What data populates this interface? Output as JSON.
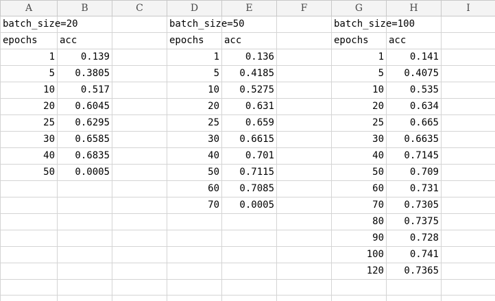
{
  "column_headers": [
    "A",
    "B",
    "C",
    "D",
    "E",
    "F",
    "G",
    "H",
    "I"
  ],
  "blocks": [
    {
      "title": "batch_size=20",
      "headers": [
        "epochs",
        "acc"
      ],
      "rows": [
        [
          "1",
          "0.139"
        ],
        [
          "5",
          "0.3805"
        ],
        [
          "10",
          "0.517"
        ],
        [
          "20",
          "0.6045"
        ],
        [
          "25",
          "0.6295"
        ],
        [
          "30",
          "0.6585"
        ],
        [
          "40",
          "0.6835"
        ],
        [
          "50",
          "0.0005"
        ]
      ]
    },
    {
      "title": "batch_size=50",
      "headers": [
        "epochs",
        "acc"
      ],
      "rows": [
        [
          "1",
          "0.136"
        ],
        [
          "5",
          "0.4185"
        ],
        [
          "10",
          "0.5275"
        ],
        [
          "20",
          "0.631"
        ],
        [
          "25",
          "0.659"
        ],
        [
          "30",
          "0.6615"
        ],
        [
          "40",
          "0.701"
        ],
        [
          "50",
          "0.7115"
        ],
        [
          "60",
          "0.7085"
        ],
        [
          "70",
          "0.0005"
        ]
      ]
    },
    {
      "title": "batch_size=100",
      "headers": [
        "epochs",
        "acc"
      ],
      "rows": [
        [
          "1",
          "0.141"
        ],
        [
          "5",
          "0.4075"
        ],
        [
          "10",
          "0.535"
        ],
        [
          "20",
          "0.634"
        ],
        [
          "25",
          "0.665"
        ],
        [
          "30",
          "0.6635"
        ],
        [
          "40",
          "0.7145"
        ],
        [
          "50",
          "0.709"
        ],
        [
          "60",
          "0.731"
        ],
        [
          "70",
          "0.7305"
        ],
        [
          "80",
          "0.7375"
        ],
        [
          "90",
          "0.728"
        ],
        [
          "100",
          "0.741"
        ],
        [
          "120",
          "0.7365"
        ]
      ]
    }
  ]
}
